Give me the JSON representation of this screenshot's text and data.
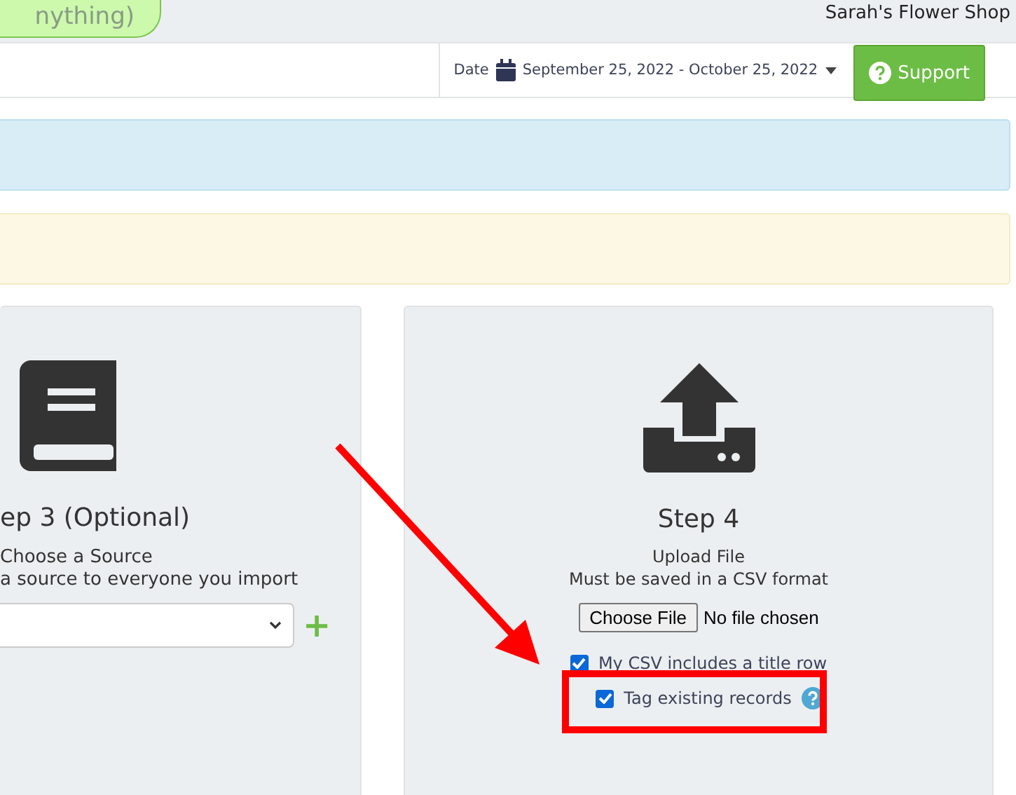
{
  "top_bar": {
    "search_pill": "nything)",
    "account": "Sarah's Flower Shop"
  },
  "toolbar": {
    "date_label": "Date",
    "date_range": "September 25, 2022 - October 25, 2022",
    "support_button": "Support"
  },
  "step3": {
    "title": "ep 3 (Optional)",
    "subtitle": "Choose a Source",
    "description": "a source to everyone you import",
    "add_symbol": "+"
  },
  "step4": {
    "title": "Step 4",
    "subtitle": "Upload File",
    "description": "Must be saved in a CSV format",
    "file_button": "Choose File",
    "file_status": "No file chosen",
    "options": [
      {
        "label": "My CSV includes a title row",
        "checked": true,
        "help": false
      },
      {
        "label": "Tag existing records",
        "checked": true,
        "help": true
      }
    ]
  }
}
